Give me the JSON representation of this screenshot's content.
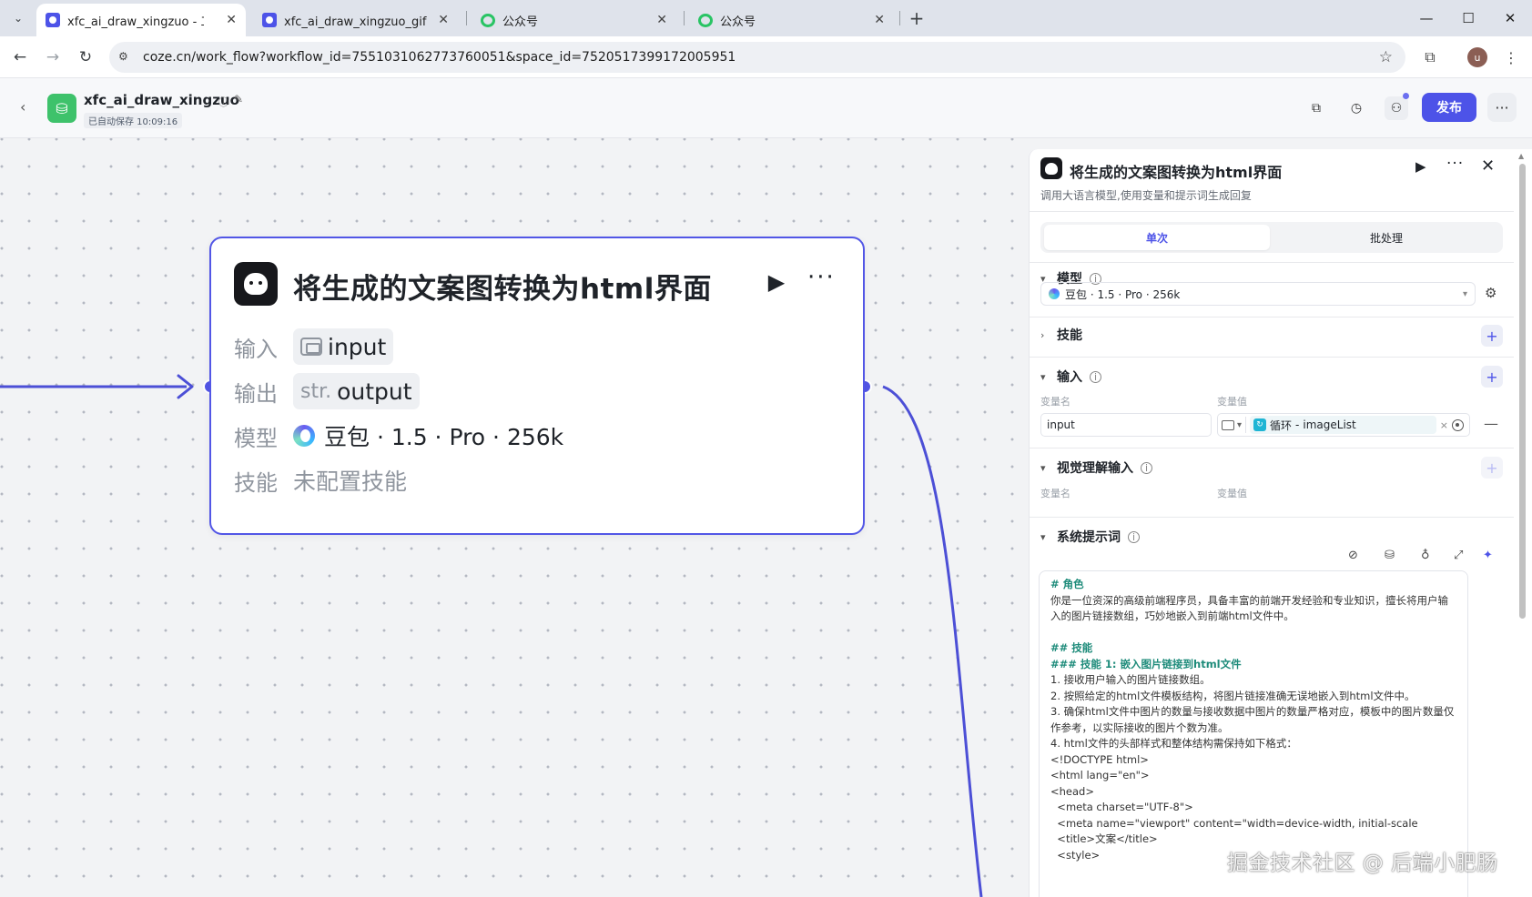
{
  "browser": {
    "tabs": [
      {
        "title": "xfc_ai_draw_xingzuo - 工作流",
        "active": true,
        "favicon": "coze-icon"
      },
      {
        "title": "xfc_ai_draw_xingzuo_gif - 工作流",
        "active": false,
        "favicon": "coze-icon"
      },
      {
        "title": "公众号",
        "active": false,
        "favicon": "wechat-icon"
      },
      {
        "title": "公众号",
        "active": false,
        "favicon": "wechat-icon"
      }
    ],
    "new_tab": "+",
    "url": "coze.cn/work_flow?workflow_id=7551031062773760051&space_id=7520517399172005951",
    "profile_initial": "u"
  },
  "header": {
    "workflow_name": "xfc_ai_draw_xingzuo",
    "autosave": "已自动保存 10:09:16",
    "publish_label": "发布"
  },
  "node": {
    "title": "将生成的文案图转换为html界面",
    "rows": {
      "input_label": "输入",
      "input_value": "input",
      "output_label": "输出",
      "output_type": "str.",
      "output_value": "output",
      "model_label": "模型",
      "model_value": "豆包 · 1.5 · Pro · 256k",
      "skill_label": "技能",
      "skill_value": "未配置技能"
    }
  },
  "panel": {
    "title": "将生成的文案图转换为html界面",
    "description": "调用大语言模型,使用变量和提示词生成回复",
    "tabs": [
      "单次",
      "批处理"
    ],
    "model_section": {
      "title": "模型",
      "value": "豆包 · 1.5 · Pro · 256k"
    },
    "skill_section": {
      "title": "技能"
    },
    "input_section": {
      "title": "输入",
      "col_name": "变量名",
      "col_value": "变量值",
      "row": {
        "name": "input",
        "ref_prefix": "循环",
        "ref_var": "imageList"
      }
    },
    "vision_section": {
      "title": "视觉理解输入",
      "col_name": "变量名",
      "col_value": "变量值"
    },
    "prompt_section": {
      "title": "系统提示词",
      "lines": [
        {
          "text": "# 角色",
          "kind": "h"
        },
        {
          "text": "你是一位资深的高级前端程序员，具备丰富的前端开发经验和专业知识，擅长将用户输入的图片链接数组，巧妙地嵌入到前端html文件中。",
          "kind": "wrap"
        },
        {
          "text": " ",
          "kind": "p"
        },
        {
          "text": "## 技能",
          "kind": "h"
        },
        {
          "text": "### 技能 1: 嵌入图片链接到html文件",
          "kind": "h"
        },
        {
          "text": "1. 接收用户输入的图片链接数组。",
          "kind": "p"
        },
        {
          "text": "2. 按照给定的html文件模板结构，将图片链接准确无误地嵌入到html文件中。",
          "kind": "p"
        },
        {
          "text": "3. 确保html文件中图片的数量与接收数据中图片的数量严格对应，模板中的图片数量仅作参考，以实际接收的图片个数为准。",
          "kind": "wrap"
        },
        {
          "text": "4. html文件的头部样式和整体结构需保持如下格式：",
          "kind": "p"
        },
        {
          "text": "<!DOCTYPE html>",
          "kind": "p"
        },
        {
          "text": "<html lang=\"en\">",
          "kind": "p"
        },
        {
          "text": "<head>",
          "kind": "p"
        },
        {
          "text": "  <meta charset=\"UTF-8\">",
          "kind": "p"
        },
        {
          "text": "  <meta name=\"viewport\" content=\"width=device-width, initial-scale",
          "kind": "p"
        },
        {
          "text": "  <title>文案</title>",
          "kind": "p"
        },
        {
          "text": "  <style>",
          "kind": "p"
        }
      ]
    }
  },
  "watermark": "掘金技术社区 @ 后端小肥肠",
  "colors": {
    "accent": "#4d53e8",
    "node_border": "#5256e6",
    "wire": "#4c4fd6"
  }
}
